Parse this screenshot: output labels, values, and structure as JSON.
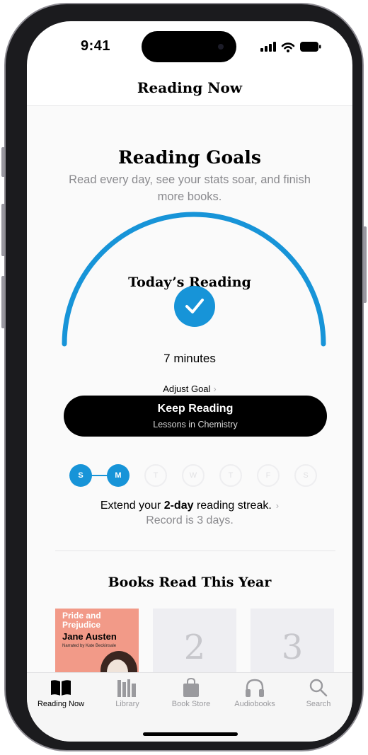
{
  "status_bar": {
    "time": "9:41"
  },
  "nav": {
    "title": "Reading Now"
  },
  "goals": {
    "title": "Reading Goals",
    "subtitle": "Read every day, see your stats soar, and finish more books."
  },
  "today": {
    "title": "Today’s Reading",
    "minutes": "7 minutes",
    "adjust_goal": "Adjust Goal",
    "progress": 1.0
  },
  "keep_reading": {
    "label": "Keep Reading",
    "book": "Lessons in Chemistry"
  },
  "week": [
    {
      "letter": "S",
      "done": true
    },
    {
      "letter": "M",
      "done": true
    },
    {
      "letter": "T",
      "done": false
    },
    {
      "letter": "W",
      "done": false
    },
    {
      "letter": "T",
      "done": false
    },
    {
      "letter": "F",
      "done": false
    },
    {
      "letter": "S",
      "done": false
    }
  ],
  "streak": {
    "prefix": "Extend your ",
    "days": "2-day",
    "suffix": " reading streak.",
    "record": "Record is 3 days."
  },
  "books_read": {
    "title": "Books Read This Year",
    "book1": {
      "title": "Pride and Prejudice",
      "author": "Jane Austen",
      "narrator": "Narrated by Kate Beckinsale"
    },
    "placeholder_2": "2",
    "placeholder_3": "3"
  },
  "tabs": [
    {
      "label": "Reading Now",
      "icon": "book-open-icon",
      "active": true
    },
    {
      "label": "Library",
      "icon": "library-icon",
      "active": false
    },
    {
      "label": "Book Store",
      "icon": "bag-icon",
      "active": false
    },
    {
      "label": "Audiobooks",
      "icon": "headphones-icon",
      "active": false
    },
    {
      "label": "Search",
      "icon": "search-icon",
      "active": false
    }
  ],
  "colors": {
    "accent": "#1794d8",
    "button_bg": "#000000",
    "secondary_text": "#8a8a8e",
    "cover_bg": "#f29a88"
  }
}
